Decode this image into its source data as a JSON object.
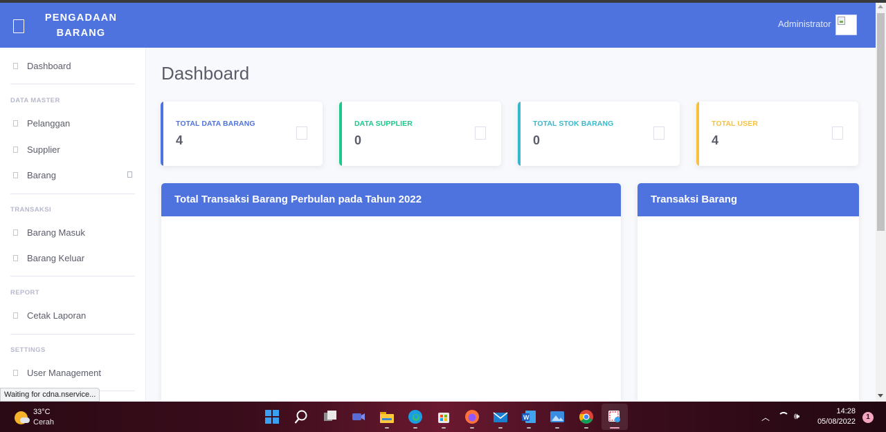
{
  "navbar": {
    "brand_line1": "PENGADAAN",
    "brand_line2": "BARANG",
    "user_name": "Administrator",
    "accent_color": "#4e73df"
  },
  "sidebar": {
    "dashboard": "Dashboard",
    "sections": [
      {
        "heading": "DATA MASTER",
        "items": [
          "Pelanggan",
          "Supplier",
          "Barang"
        ]
      },
      {
        "heading": "TRANSAKSI",
        "items": [
          "Barang Masuk",
          "Barang Keluar"
        ]
      },
      {
        "heading": "REPORT",
        "items": [
          "Cetak Laporan"
        ]
      },
      {
        "heading": "SETTINGS",
        "items": [
          "User Management"
        ]
      }
    ]
  },
  "page": {
    "title": "Dashboard"
  },
  "cards": [
    {
      "label": "TOTAL DATA BARANG",
      "value": "4",
      "color": "#4e73df"
    },
    {
      "label": "DATA SUPPLIER",
      "value": "0",
      "color": "#1cc88a"
    },
    {
      "label": "TOTAL STOK BARANG",
      "value": "0",
      "color": "#36b9cc"
    },
    {
      "label": "TOTAL USER",
      "value": "4",
      "color": "#f6c23e"
    }
  ],
  "panels": {
    "chart_title": "Total Transaksi Barang Perbulan pada Tahun 2022",
    "transaksi_title": "Transaksi Barang"
  },
  "browser": {
    "status_text": "Waiting for cdna.nservice..."
  },
  "taskbar": {
    "weather_temp": "33°C",
    "weather_desc": "Cerah",
    "time": "14:28",
    "date": "05/08/2022",
    "notification_count": "1",
    "apps": [
      "start-icon",
      "search-icon",
      "task-view-icon",
      "chat-icon",
      "file-explorer-icon",
      "edge-icon",
      "store-icon",
      "firefox-icon",
      "mail-icon",
      "word-icon",
      "photos-icon",
      "chrome-icon",
      "snipping-tool-icon"
    ]
  }
}
